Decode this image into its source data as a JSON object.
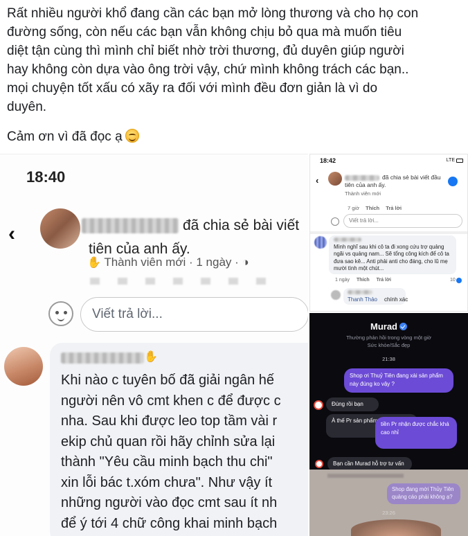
{
  "post": {
    "paragraph_lines": [
      "Rất nhiều người khổ đang cần các bạn mở lòng thương và cho họ con",
      "đường sống, còn nếu các bạn vẫn không chịu bỏ qua mà muốn tiêu",
      "diệt tận cùng thì mình chỉ biết nhờ trời thương, đủ duyên giúp người",
      "hay không còn dựa vào ông trời vậy, chứ mình không trách các bạn..",
      "mọi chuyện tốt xấu có xãy ra đối với mình đều đơn giản là vì do",
      "duyên."
    ],
    "thanks": "Cảm ơn vì đã đọc ạ",
    "thanks_emoji": "smiling-face-icon"
  },
  "left_screenshot": {
    "time": "18:40",
    "back_icon": "chevron-left-icon",
    "share_text": "đã chia sẻ bài viết tiên của anh ấy.",
    "meta": "Thành viên mới · 1 ngày ·",
    "reply_placeholder": "Viết trả lời...",
    "comment_lines": [
      "Khi nào c tuyên bố đã giải ngân hế",
      "người nên vô cmt khen c để được c",
      "nha. Sau khi được leo top tầm vài r",
      "ekip chủ quan rồi hãy chỉnh sửa lại",
      "thành \"Yêu cầu minh bạch thu chi\"",
      "xin lỗi bác t.xóm chưa\". Như vậy ít",
      "những người vào đọc cmt sau ít nh",
      "để ý tới 4 chữ công khai minh bạch"
    ]
  },
  "right_top_screenshot": {
    "time": "18:42",
    "network": "LTE",
    "share_line1": "đã chia sẻ bài viết đầu",
    "share_line2": "tiên của anh ấy.",
    "meta": "Thành viên mới",
    "actions": [
      "7 giờ",
      "Thích",
      "Trả lời"
    ],
    "reply_placeholder": "Viết trả lời...",
    "comment_text": "Mình nghĩ sau khi cô ta đi xong cứu trợ quảng ngãi vs quảng nam... Sẽ tổng công kích để cô ta đưa sao kê... Anti phải anti cho đáng, cho lũ mẹ mười tình một chút...",
    "comment_actions": [
      "1 ngày",
      "Thích",
      "Trả lời"
    ],
    "like_count": "10",
    "reply_name": "Thanh Thảo",
    "reply_text": "chính xác"
  },
  "right_chat_screenshot": {
    "contact": "Murad",
    "subtitle1": "Thường phản hồi trong vòng một giờ",
    "subtitle2": "Sức khỏe/Sắc đẹp",
    "time": "21:38",
    "msg_out_1": "Shop ơi Thuỷ Tiên đang xài sản phẩm này đúng ko vậy ?",
    "msg_in_1": "Đúng rồi bạn",
    "msg_in_2": "À thế Pr sản phẩm cho hãng thì",
    "msg_out_2": "tiền Pr nhận được chắc khá cao nhỉ",
    "msg_in_3": "Bạn cần Murad hỗ trợ tư vấn"
  },
  "right_bottom_screenshot": {
    "msg_out": "Shop đang mời Thủy Tiên quảng cáo phải không ạ?",
    "time": "23:26"
  }
}
